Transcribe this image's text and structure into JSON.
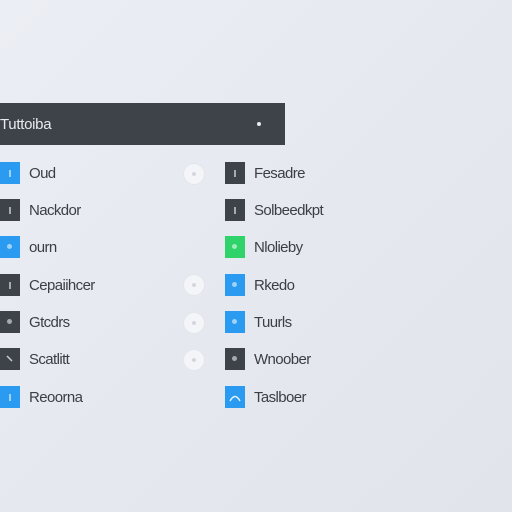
{
  "header": {
    "title": "Tuttoiba"
  },
  "left_items": [
    {
      "label": "Oud",
      "icon": "blue-square-icon",
      "color": "#2a9bf0"
    },
    {
      "label": "Nackdor",
      "icon": "dark-square-icon",
      "color": "#3d4349"
    },
    {
      "label": "ourn",
      "icon": "blue-square-icon",
      "color": "#2a9bf0"
    },
    {
      "label": "Cepaiihcer",
      "icon": "dark-square-icon",
      "color": "#3d4349"
    },
    {
      "label": "Gtcdrs",
      "icon": "dark-square-icon",
      "color": "#3d4349"
    },
    {
      "label": "Scatlitt",
      "icon": "dark-square-icon",
      "color": "#3d4349"
    },
    {
      "label": "Reoorna",
      "icon": "blue-square-icon",
      "color": "#2a9bf0"
    }
  ],
  "right_items": [
    {
      "label": "Fesadre",
      "icon": "dark-square-icon",
      "color": "#3d4349"
    },
    {
      "label": "Solbeedkpt",
      "icon": "dark-square-icon",
      "color": "#3d4349"
    },
    {
      "label": "Nlolieby",
      "icon": "green-square-icon",
      "color": "#2fd36a"
    },
    {
      "label": "Rkedo",
      "icon": "blue-square-icon",
      "color": "#2a9bf0"
    },
    {
      "label": "Tuurls",
      "icon": "blue-square-icon",
      "color": "#2a9bf0"
    },
    {
      "label": "Wnoober",
      "icon": "dark-square-icon",
      "color": "#3d4349"
    },
    {
      "label": "Taslboer",
      "icon": "blue-square-icon",
      "color": "#2a9bf0"
    }
  ],
  "radios": [
    {
      "row": 0
    },
    {
      "row": 3
    },
    {
      "row": 4
    },
    {
      "row": 5
    }
  ]
}
